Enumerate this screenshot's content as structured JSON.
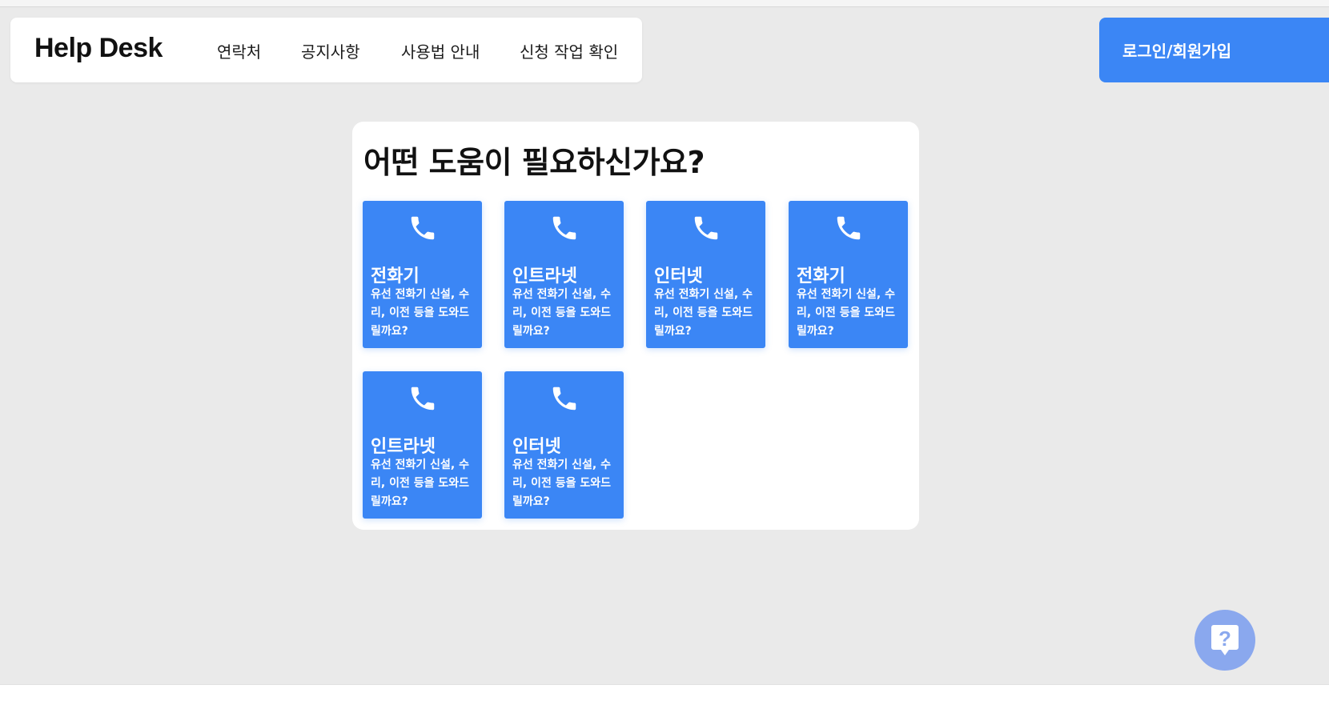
{
  "app": {
    "brand": "Help Desk"
  },
  "nav": {
    "items": [
      {
        "label": "연락처"
      },
      {
        "label": "공지사항"
      },
      {
        "label": "사용법 안내"
      },
      {
        "label": "신청 작업 확인"
      }
    ],
    "login_label": "로그인/회원가입"
  },
  "main": {
    "title": "어떤 도움이 필요하신가요?",
    "cards": [
      {
        "title": "전화기",
        "desc": "유선 전화기 신설, 수리, 이전 등을 도와드릴까요?",
        "icon": "phone-icon"
      },
      {
        "title": "인트라넷",
        "desc": "유선 전화기 신설, 수리, 이전 등을 도와드릴까요?",
        "icon": "phone-icon"
      },
      {
        "title": "인터넷",
        "desc": "유선 전화기 신설, 수리, 이전 등을 도와드릴까요?",
        "icon": "phone-icon"
      },
      {
        "title": "전화기",
        "desc": "유선 전화기 신설, 수리, 이전 등을 도와드릴까요?",
        "icon": "phone-icon"
      },
      {
        "title": "인트라넷",
        "desc": "유선 전화기 신설, 수리, 이전 등을 도와드릴까요?",
        "icon": "phone-icon"
      },
      {
        "title": "인터넷",
        "desc": "유선 전화기 신설, 수리, 이전 등을 도와드릴까요?",
        "icon": "phone-icon"
      }
    ]
  },
  "help_button": {
    "icon": "help-question-icon"
  },
  "colors": {
    "accent": "#3b86f5",
    "background": "#eaeaea",
    "help_button": "#8aa8ee"
  }
}
